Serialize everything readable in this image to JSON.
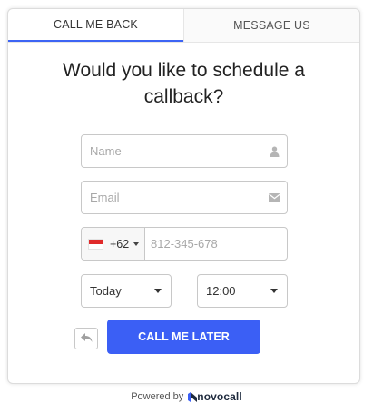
{
  "tabs": [
    {
      "label": "CALL ME BACK",
      "active": true
    },
    {
      "label": "MESSAGE US",
      "active": false
    }
  ],
  "heading": {
    "line1": "Would you like to schedule a",
    "line2": "callback?"
  },
  "form": {
    "name_placeholder": "Name",
    "email_placeholder": "Email",
    "phone": {
      "country_code": "+62",
      "flag": "indonesia-flag",
      "placeholder": "812-345-678"
    },
    "day_select": "Today",
    "time_select": "12:00"
  },
  "actions": {
    "back_icon": "reply-arrow-icon",
    "submit_label": "CALL ME LATER"
  },
  "footer": {
    "powered_by": "Powered by",
    "brand": "novocall"
  },
  "colors": {
    "accent": "#3b5ff5",
    "tab_underline": "#3d64f4"
  }
}
